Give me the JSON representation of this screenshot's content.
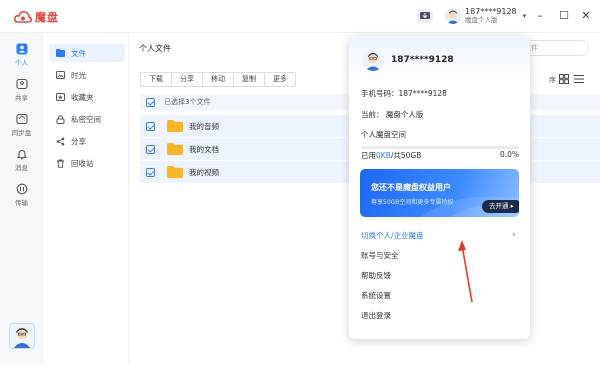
{
  "app": {
    "name": "魔盘"
  },
  "header": {
    "user_name": "187****9128",
    "user_plan": "魔盘个人版"
  },
  "rail": [
    {
      "label": "个人",
      "icon": "person-icon",
      "active": true
    },
    {
      "label": "共享",
      "icon": "share-folder-icon"
    },
    {
      "label": "同步盘",
      "icon": "sync-icon"
    },
    {
      "label": "消息",
      "icon": "bell-icon"
    },
    {
      "label": "传输",
      "icon": "transfer-icon"
    }
  ],
  "sidebar": [
    {
      "label": "文件",
      "icon": "folder-icon",
      "active": true
    },
    {
      "label": "时光",
      "icon": "image-icon"
    },
    {
      "label": "收藏夹",
      "icon": "star-icon"
    },
    {
      "label": "私密空间",
      "icon": "lock-icon"
    },
    {
      "label": "分享",
      "icon": "share-icon"
    },
    {
      "label": "回收站",
      "icon": "trash-icon"
    }
  ],
  "main": {
    "breadcrumb": "个人文件",
    "search_placeholder": "文件",
    "sort_label": "序",
    "toolbar": [
      "下载",
      "分享",
      "移动",
      "复制",
      "更多"
    ],
    "selection_text": "已选择3个文件",
    "files": [
      {
        "name": "我的音频",
        "checked": true
      },
      {
        "name": "我的文档",
        "checked": true
      },
      {
        "name": "我的视频",
        "checked": true
      }
    ]
  },
  "popup": {
    "name": "187****9128",
    "phone_line": "手机号码：187****9128",
    "current_line": "当前：  魔盘个人版",
    "space_title": "个人魔盘空间",
    "used_prefix": "已用",
    "used_value": "0KB",
    "used_suffix": "/共50GB",
    "used_percent": "0.0%",
    "used_fraction": 0.0,
    "promo": {
      "title": "您还不是魔盘权益用户",
      "subtitle": "尊享50GB空间和更多专属特权",
      "button": "去开通"
    },
    "menu": [
      {
        "label": "切换个人/企业魔盘",
        "highlight": true
      },
      {
        "label": "账号与安全"
      },
      {
        "label": "帮助反馈"
      },
      {
        "label": "系统设置"
      },
      {
        "label": "退出登录"
      }
    ]
  },
  "colors": {
    "accent": "#2f7bf5",
    "logo": "#e24a4a",
    "arrow": "#e53935"
  }
}
